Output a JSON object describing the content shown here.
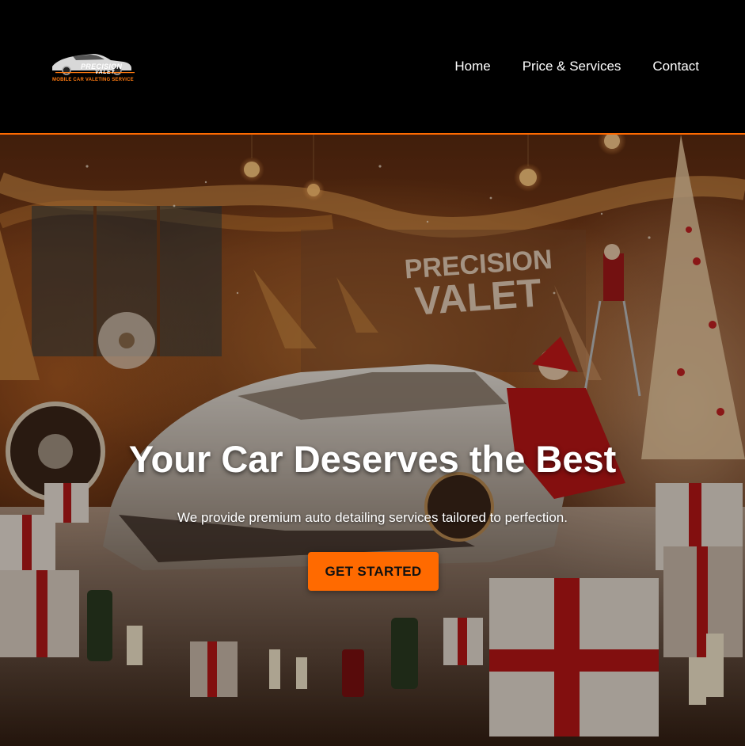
{
  "header": {
    "logo": {
      "word1": "PRECISION",
      "word2": "VALET",
      "tagline": "MOBILE CAR VALETING SERVICE"
    },
    "nav": [
      {
        "label": "Home"
      },
      {
        "label": "Price & Services"
      },
      {
        "label": "Contact"
      }
    ]
  },
  "hero": {
    "banner_sign_line1": "PRECISION",
    "banner_sign_line2": "VALET",
    "title": "Your Car Deserves the Best",
    "subtitle": "We provide premium auto detailing services tailored to perfection.",
    "cta_label": "GET STARTED"
  },
  "colors": {
    "accent": "#ff6a00",
    "header_bg": "#000000",
    "text": "#ffffff"
  }
}
